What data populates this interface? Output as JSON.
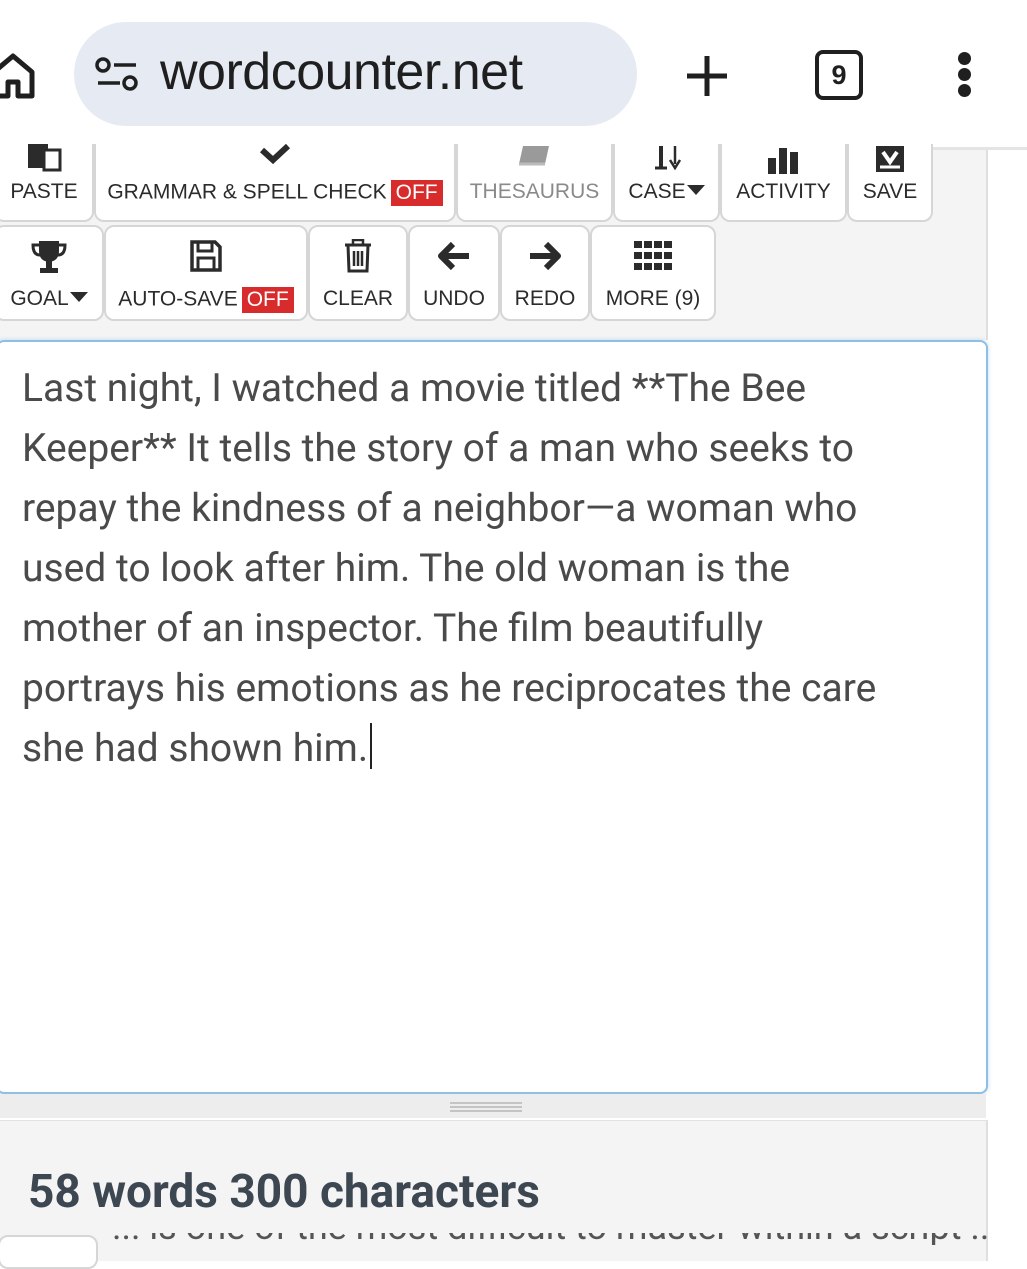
{
  "browser": {
    "url": "wordcounter.net",
    "tab_count": "9"
  },
  "toolbar": {
    "row1": [
      {
        "id": "paste",
        "label": "PASTE"
      },
      {
        "id": "grammar",
        "label": "GRAMMAR & SPELL CHECK",
        "badge": "OFF"
      },
      {
        "id": "thesaurus",
        "label": "THESAURUS"
      },
      {
        "id": "case",
        "label": "CASE"
      },
      {
        "id": "activity",
        "label": "ACTIVITY"
      },
      {
        "id": "save",
        "label": "SAVE"
      }
    ],
    "row2": [
      {
        "id": "goal",
        "label": "GOAL"
      },
      {
        "id": "autosave",
        "label": "AUTO-SAVE",
        "badge": "OFF"
      },
      {
        "id": "clear",
        "label": "CLEAR"
      },
      {
        "id": "undo",
        "label": "UNDO"
      },
      {
        "id": "redo",
        "label": "REDO"
      },
      {
        "id": "more",
        "label": "MORE (9)"
      }
    ]
  },
  "editor": {
    "lines": [
      "Last night, I watched a movie titled **The Bee",
      "Keeper** It tells the story of a man who seeks to",
      "repay the kindness of a neighbor—a woman who",
      "used to look after him. The old woman is the",
      "mother of an inspector. The film beautifully",
      "portrays his emotions as he reciprocates the care",
      "she had shown him."
    ]
  },
  "stats": {
    "summary": "58 words 300 characters",
    "cut_text": "... is one of the most difficult to master within a script ..."
  },
  "colors": {
    "off_badge": "#d82b2b",
    "editor_border": "#8ebfe6",
    "url_pill": "#e6ebf3"
  }
}
